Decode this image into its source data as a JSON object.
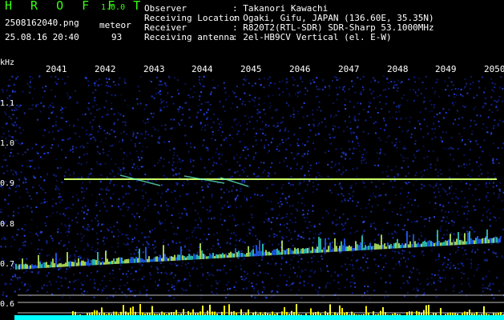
{
  "header": {
    "app_title": "H R O F F T",
    "version": "1.0.0",
    "filename": "2508162040.png",
    "datetime": "25.08.16 20:40",
    "meteor_label": "meteor",
    "meteor_count": "93",
    "info": [
      {
        "key": "Observer",
        "value": ": Takanori Kawachi"
      },
      {
        "key": "Receiving Location",
        "value": ": Ogaki, Gifu, JAPAN (136.60E, 35.35N)"
      },
      {
        "key": "Receiver",
        "value": ": R820T2(RTL-SDR) SDR-Sharp 53.1000MHz"
      },
      {
        "key": "Receiving antenna",
        "value": ": 2el-HB9CV Vertical (el. E-W)"
      }
    ]
  },
  "axes": {
    "y_unit": "kHz",
    "y_ticks": [
      "1.1",
      "1.0",
      "0.9",
      "0.8",
      "0.7",
      "0.6"
    ],
    "x_ticks": [
      "2041",
      "2042",
      "2043",
      "2044",
      "2045",
      "2046",
      "2047",
      "2048",
      "2049",
      "2050"
    ]
  },
  "colors": {
    "title": "#39ff14",
    "background": "#000000",
    "noise": "#0a1a8a",
    "signal": "#ccff66",
    "bottom_bar": "#00ffff"
  }
}
